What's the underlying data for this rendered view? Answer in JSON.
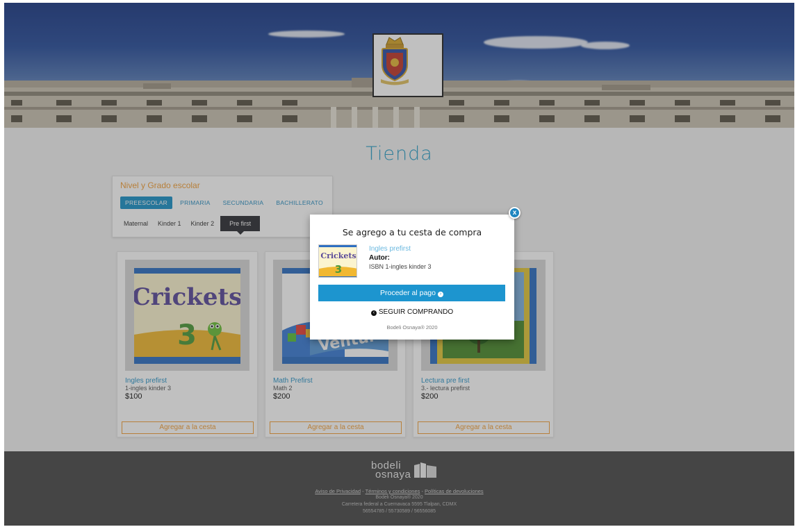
{
  "page": {
    "title": "Tienda"
  },
  "filter": {
    "title": "Nivel y Grado escolar",
    "levels": [
      "PREESCOLAR",
      "PRIMARIA",
      "SECUNDARIA",
      "BACHILLERATO"
    ],
    "active_level": "PREESCOLAR",
    "grades": [
      "Maternal",
      "Kinder 1",
      "Kinder 2",
      "Pre first"
    ],
    "active_grade": "Pre first"
  },
  "products": [
    {
      "name": "Ingles prefirst",
      "author": "1-ingles kinder 3",
      "price": "$100",
      "button": "Agregar a la cesta",
      "cover_text": "Crickets",
      "cover_number": "3"
    },
    {
      "name": "Math Prefirst",
      "author": "Math 2",
      "price": "$200",
      "button": "Agregar a la cesta",
      "cover_text": "Ventur"
    },
    {
      "name": "Lectura pre first",
      "author": "3.- lectura prefirst",
      "price": "$200",
      "button": "Agregar a la cesta"
    }
  ],
  "modal": {
    "title": "Se agrego a tu cesta de compra",
    "product_name": "Ingles prefirst",
    "author_label": "Autor:",
    "isbn": "ISBN 1-ingles kinder 3",
    "pay_button": "Proceder al pago",
    "continue_button": "SEGUIR COMPRANDO",
    "copyright": "Bodeli Osnaya® 2020",
    "close": "x",
    "thumb_text": "Crickets",
    "thumb_number": "3"
  },
  "footer": {
    "logo_line1": "bodeli",
    "logo_line2": "osnaya",
    "links": [
      "Aviso de Privacidad",
      "Términos y condiciones",
      "Políticas de devoluciones"
    ],
    "separator": " - ",
    "copyright": "Bodeli Osnaya® 2020",
    "address": "Carretera federal a Cuernavaca 5595 Tlalpan, CDMX",
    "phones": "56554785 / 55730589 / 56556085"
  },
  "colors": {
    "accent_blue": "#1d95cf",
    "accent_orange": "#f2a03a",
    "footer_bg": "#4b4b4b",
    "title_blue": "#2d9fc8"
  }
}
